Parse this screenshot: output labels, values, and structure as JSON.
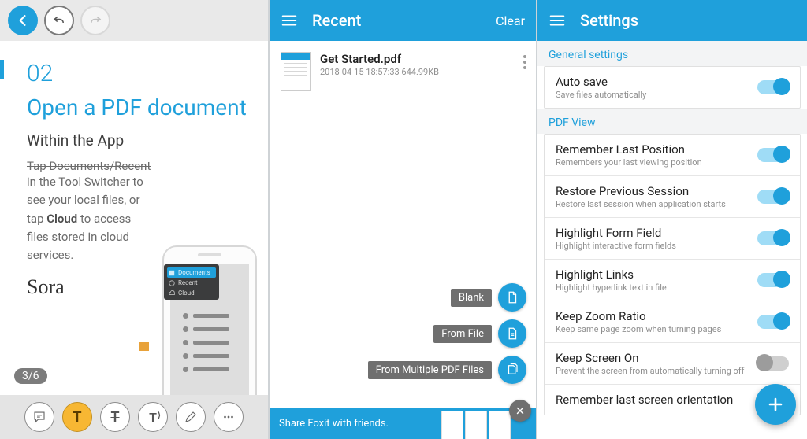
{
  "pane1": {
    "page_number": "02",
    "heading": "Open a PDF document",
    "subheading": "Within the App",
    "strike_line": "Tap Documents/Recent",
    "body_html_parts": {
      "pre": "in  the Tool Switcher to see your local files, or tap ",
      "bold": "Cloud",
      "post": " to access files stored in cloud services."
    },
    "signature": "Sora",
    "menu_items": {
      "documents": "Documents",
      "recent": "Recent",
      "cloud": "Cloud"
    },
    "page_indicator": "3/6",
    "tools": [
      "comment",
      "highlight",
      "strikethrough",
      "text-edit",
      "draw",
      "more"
    ]
  },
  "pane2": {
    "title": "Recent",
    "clear": "Clear",
    "file": {
      "name": "Get Started.pdf",
      "meta": "2018-04-15 18:57:33 644.99KB"
    },
    "fab": {
      "blank": "Blank",
      "from_file": "From File",
      "from_multiple": "From Multiple PDF Files"
    },
    "banner": "Share Foxit with friends."
  },
  "pane3": {
    "title": "Settings",
    "general_label": "General settings",
    "pdfview_label": "PDF View",
    "settings": {
      "autosave": {
        "title": "Auto save",
        "sub": "Save files automatically",
        "on": true
      },
      "remember_pos": {
        "title": "Remember Last Position",
        "sub": "Remembers your last viewing position",
        "on": true
      },
      "restore_sess": {
        "title": "Restore Previous Session",
        "sub": "Restore last session when application starts",
        "on": true
      },
      "hl_form": {
        "title": "Highlight Form Field",
        "sub": "Highlight interactive form fields",
        "on": true
      },
      "hl_links": {
        "title": "Highlight Links",
        "sub": "Highlight hyperlink text in file",
        "on": true
      },
      "keep_zoom": {
        "title": "Keep Zoom Ratio",
        "sub": "Keep same page zoom when turning pages",
        "on": true
      },
      "keep_screen": {
        "title": "Keep Screen On",
        "sub": "Prevent the screen from automatically turning off",
        "on": false
      },
      "remember_orient": {
        "title": "Remember last screen orientation",
        "sub": "",
        "on": true
      }
    }
  }
}
